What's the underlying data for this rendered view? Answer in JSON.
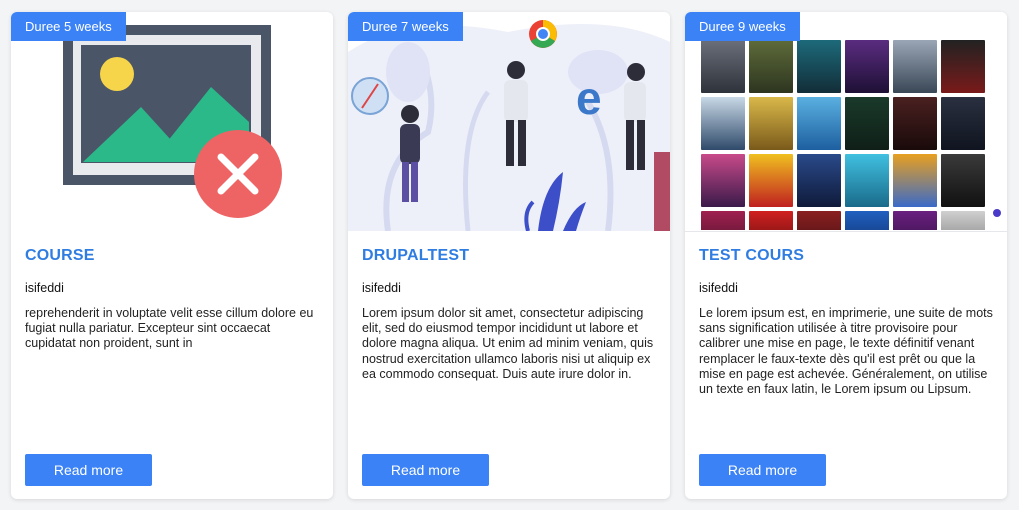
{
  "cards": [
    {
      "badge": "Duree 5 weeks",
      "title": "COURSE",
      "author": "isifeddi",
      "description": "reprehenderit in voluptate velit esse cillum dolore eu fugiat nulla pariatur. Excepteur sint occaecat cupidatat non proident, sunt in",
      "button": "Read more",
      "image": "broken-image-icon"
    },
    {
      "badge": "Duree 7 weeks",
      "title": "DRUPALTEST",
      "author": "isifeddi",
      "description": "Lorem ipsum dolor sit amet, consectetur adipiscing elit, sed do eiusmod tempor incididunt ut labore et dolore magna aliqua. Ut enim ad minim veniam, quis nostrud exercitation ullamco laboris nisi ut aliquip ex ea commodo consequat. Duis aute irure dolor in.",
      "button": "Read more",
      "image": "browsers-illustration"
    },
    {
      "badge": "Duree 9 weeks",
      "title": "TEST COURS",
      "author": "isifeddi",
      "description": "Le lorem ipsum est, en imprimerie, une suite de mots sans signification utilisée à titre provisoire pour calibrer une mise en page, le texte définitif venant remplacer le faux-texte dès qu'il est prêt ou que la mise en page est achevée. Généralement, on utilise un texte en faux latin, le Lorem ipsum ou Lipsum.",
      "button": "Read more",
      "image": "movie-posters-screenshot"
    }
  ]
}
